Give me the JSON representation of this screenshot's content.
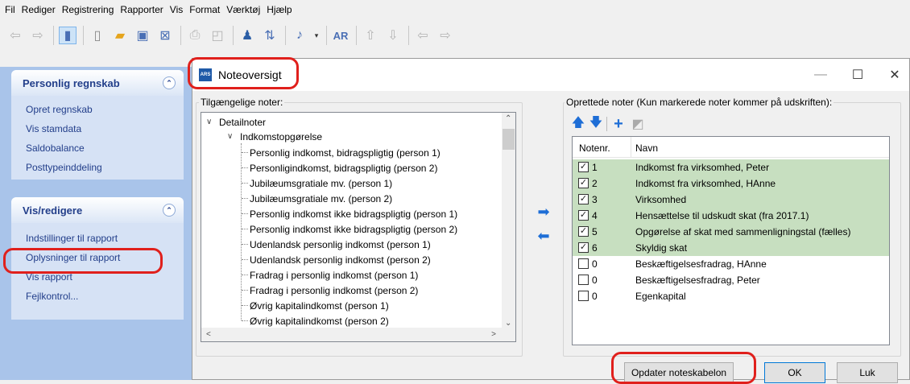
{
  "menu": [
    "Fil",
    "Rediger",
    "Registrering",
    "Rapporter",
    "Vis",
    "Format",
    "Værktøj",
    "Hjælp"
  ],
  "left_pane": {
    "group1": {
      "title": "Personlig regnskab",
      "items": [
        "Opret regnskab",
        "Vis stamdata",
        "Saldobalance",
        "Posttypeinddeling"
      ]
    },
    "group2": {
      "title": "Vis/redigere",
      "items": [
        "Indstillinger til rapport",
        "Oplysninger til rapport",
        "Vis rapport",
        "Fejlkontrol..."
      ]
    }
  },
  "dialog": {
    "title": "Noteoversigt",
    "icon_text": "ARS",
    "available_label": "Tilgængelige noter:",
    "created_label": "Oprettede noter (Kun markerede noter kommer på udskriften):",
    "tree": {
      "root": "Detailnoter",
      "child": "Indkomstopgørelse",
      "leaves": [
        "Personlig indkomst, bidragspligtig (person 1)",
        "Personligindkomst, bidragspligtig (person 2)",
        "Jubilæumsgratiale mv. (person 1)",
        "Jubilæumsgratiale mv. (person 2)",
        "Personlig indkomst ikke bidragspligtig (person 1)",
        "Personlig indkomst ikke bidragspligtig (person 2)",
        "Udenlandsk personlig indkomst (person 1)",
        "Udenlandsk personlig indkomst (person 2)",
        "Fradrag i personlig indkomst (person 1)",
        "Fradrag i personlig indkomst (person 2)",
        "Øvrig kapitalindkomst (person 1)",
        "Øvrig kapitalindkomst (person 2)"
      ]
    },
    "list_headers": {
      "num": "Notenr.",
      "name": "Navn"
    },
    "notes": [
      {
        "checked": true,
        "num": "1",
        "name": "Indkomst fra virksomhed, Peter"
      },
      {
        "checked": true,
        "num": "2",
        "name": "Indkomst fra virksomhed, HAnne"
      },
      {
        "checked": true,
        "num": "3",
        "name": "Virksomhed"
      },
      {
        "checked": true,
        "num": "4",
        "name": "Hensættelse til udskudt skat (fra 2017.1)"
      },
      {
        "checked": true,
        "num": "5",
        "name": "Opgørelse af skat med sammenligningstal (fælles)"
      },
      {
        "checked": true,
        "num": "6",
        "name": "Skyldig skat"
      },
      {
        "checked": false,
        "num": "0",
        "name": "Beskæftigelsesfradrag, HAnne"
      },
      {
        "checked": false,
        "num": "0",
        "name": "Beskæftigelsesfradrag, Peter"
      },
      {
        "checked": false,
        "num": "0",
        "name": "Egenkapital"
      }
    ],
    "buttons": {
      "update": "Opdater noteskabelon",
      "ok": "OK",
      "close": "Luk"
    },
    "highlight_color": "#c7dfc0",
    "annotation_color": "#e0201c"
  }
}
